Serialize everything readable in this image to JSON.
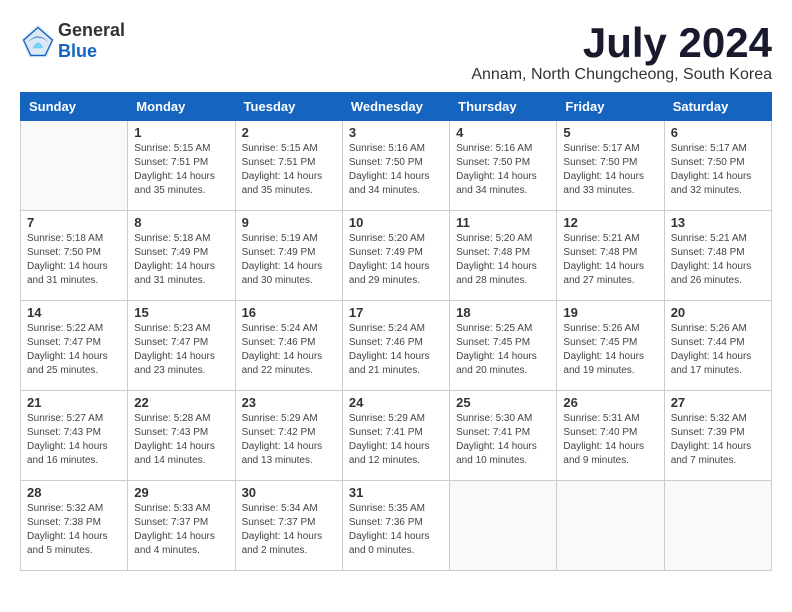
{
  "logo": {
    "general": "General",
    "blue": "Blue"
  },
  "title": {
    "month": "July 2024",
    "location": "Annam, North Chungcheong, South Korea"
  },
  "weekdays": [
    "Sunday",
    "Monday",
    "Tuesday",
    "Wednesday",
    "Thursday",
    "Friday",
    "Saturday"
  ],
  "weeks": [
    [
      {
        "day": "",
        "info": ""
      },
      {
        "day": "1",
        "info": "Sunrise: 5:15 AM\nSunset: 7:51 PM\nDaylight: 14 hours\nand 35 minutes."
      },
      {
        "day": "2",
        "info": "Sunrise: 5:15 AM\nSunset: 7:51 PM\nDaylight: 14 hours\nand 35 minutes."
      },
      {
        "day": "3",
        "info": "Sunrise: 5:16 AM\nSunset: 7:50 PM\nDaylight: 14 hours\nand 34 minutes."
      },
      {
        "day": "4",
        "info": "Sunrise: 5:16 AM\nSunset: 7:50 PM\nDaylight: 14 hours\nand 34 minutes."
      },
      {
        "day": "5",
        "info": "Sunrise: 5:17 AM\nSunset: 7:50 PM\nDaylight: 14 hours\nand 33 minutes."
      },
      {
        "day": "6",
        "info": "Sunrise: 5:17 AM\nSunset: 7:50 PM\nDaylight: 14 hours\nand 32 minutes."
      }
    ],
    [
      {
        "day": "7",
        "info": "Sunrise: 5:18 AM\nSunset: 7:50 PM\nDaylight: 14 hours\nand 31 minutes."
      },
      {
        "day": "8",
        "info": "Sunrise: 5:18 AM\nSunset: 7:49 PM\nDaylight: 14 hours\nand 31 minutes."
      },
      {
        "day": "9",
        "info": "Sunrise: 5:19 AM\nSunset: 7:49 PM\nDaylight: 14 hours\nand 30 minutes."
      },
      {
        "day": "10",
        "info": "Sunrise: 5:20 AM\nSunset: 7:49 PM\nDaylight: 14 hours\nand 29 minutes."
      },
      {
        "day": "11",
        "info": "Sunrise: 5:20 AM\nSunset: 7:48 PM\nDaylight: 14 hours\nand 28 minutes."
      },
      {
        "day": "12",
        "info": "Sunrise: 5:21 AM\nSunset: 7:48 PM\nDaylight: 14 hours\nand 27 minutes."
      },
      {
        "day": "13",
        "info": "Sunrise: 5:21 AM\nSunset: 7:48 PM\nDaylight: 14 hours\nand 26 minutes."
      }
    ],
    [
      {
        "day": "14",
        "info": "Sunrise: 5:22 AM\nSunset: 7:47 PM\nDaylight: 14 hours\nand 25 minutes."
      },
      {
        "day": "15",
        "info": "Sunrise: 5:23 AM\nSunset: 7:47 PM\nDaylight: 14 hours\nand 23 minutes."
      },
      {
        "day": "16",
        "info": "Sunrise: 5:24 AM\nSunset: 7:46 PM\nDaylight: 14 hours\nand 22 minutes."
      },
      {
        "day": "17",
        "info": "Sunrise: 5:24 AM\nSunset: 7:46 PM\nDaylight: 14 hours\nand 21 minutes."
      },
      {
        "day": "18",
        "info": "Sunrise: 5:25 AM\nSunset: 7:45 PM\nDaylight: 14 hours\nand 20 minutes."
      },
      {
        "day": "19",
        "info": "Sunrise: 5:26 AM\nSunset: 7:45 PM\nDaylight: 14 hours\nand 19 minutes."
      },
      {
        "day": "20",
        "info": "Sunrise: 5:26 AM\nSunset: 7:44 PM\nDaylight: 14 hours\nand 17 minutes."
      }
    ],
    [
      {
        "day": "21",
        "info": "Sunrise: 5:27 AM\nSunset: 7:43 PM\nDaylight: 14 hours\nand 16 minutes."
      },
      {
        "day": "22",
        "info": "Sunrise: 5:28 AM\nSunset: 7:43 PM\nDaylight: 14 hours\nand 14 minutes."
      },
      {
        "day": "23",
        "info": "Sunrise: 5:29 AM\nSunset: 7:42 PM\nDaylight: 14 hours\nand 13 minutes."
      },
      {
        "day": "24",
        "info": "Sunrise: 5:29 AM\nSunset: 7:41 PM\nDaylight: 14 hours\nand 12 minutes."
      },
      {
        "day": "25",
        "info": "Sunrise: 5:30 AM\nSunset: 7:41 PM\nDaylight: 14 hours\nand 10 minutes."
      },
      {
        "day": "26",
        "info": "Sunrise: 5:31 AM\nSunset: 7:40 PM\nDaylight: 14 hours\nand 9 minutes."
      },
      {
        "day": "27",
        "info": "Sunrise: 5:32 AM\nSunset: 7:39 PM\nDaylight: 14 hours\nand 7 minutes."
      }
    ],
    [
      {
        "day": "28",
        "info": "Sunrise: 5:32 AM\nSunset: 7:38 PM\nDaylight: 14 hours\nand 5 minutes."
      },
      {
        "day": "29",
        "info": "Sunrise: 5:33 AM\nSunset: 7:37 PM\nDaylight: 14 hours\nand 4 minutes."
      },
      {
        "day": "30",
        "info": "Sunrise: 5:34 AM\nSunset: 7:37 PM\nDaylight: 14 hours\nand 2 minutes."
      },
      {
        "day": "31",
        "info": "Sunrise: 5:35 AM\nSunset: 7:36 PM\nDaylight: 14 hours\nand 0 minutes."
      },
      {
        "day": "",
        "info": ""
      },
      {
        "day": "",
        "info": ""
      },
      {
        "day": "",
        "info": ""
      }
    ]
  ]
}
